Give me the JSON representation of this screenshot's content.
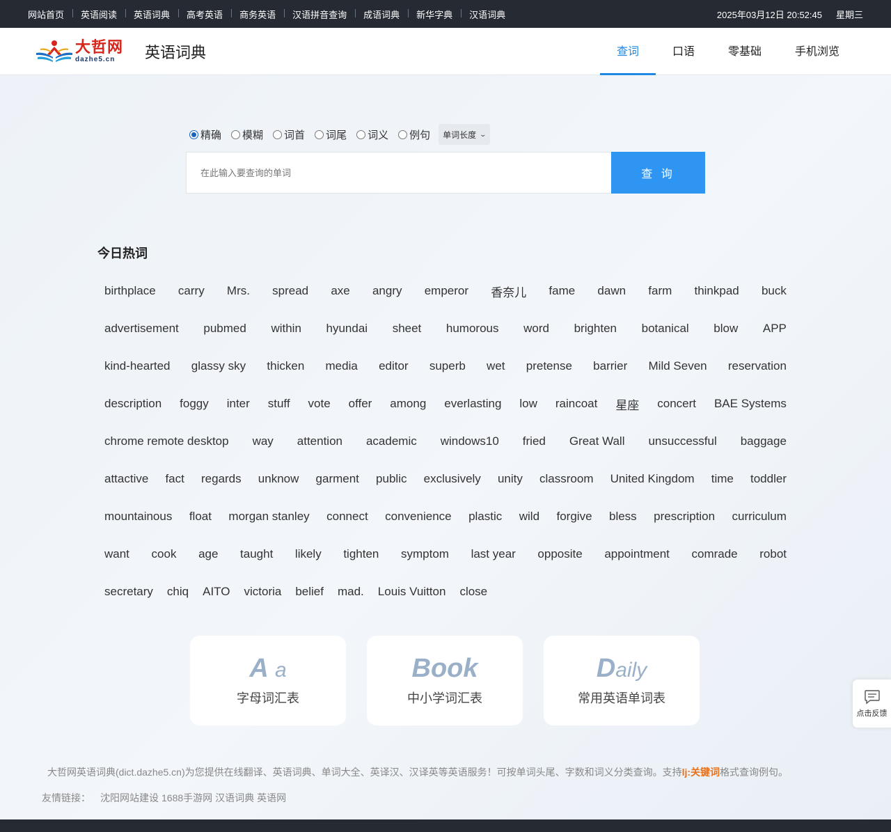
{
  "topbar": {
    "links": [
      "网站首页",
      "英语阅读",
      "英语词典",
      "高考英语",
      "商务英语",
      "汉语拼音查询",
      "成语词典",
      "新华字典",
      "汉语词典"
    ],
    "datetime": "2025年03月12日 20:52:45",
    "weekday": "星期三"
  },
  "header": {
    "logo_cn": "大哲网",
    "logo_en": "dazhe5.cn",
    "site_title": "英语词典",
    "nav": [
      "查词",
      "口语",
      "零基础",
      "手机浏览"
    ],
    "active_nav": "查词"
  },
  "search": {
    "modes": [
      "精确",
      "模糊",
      "词首",
      "词尾",
      "词义",
      "例句"
    ],
    "selected_mode": "精确",
    "length_select": "单词长度",
    "placeholder": "在此输入要查询的单词",
    "value": "",
    "button": "查 询"
  },
  "hot": {
    "title": "今日热词",
    "rows": [
      [
        "birthplace",
        "carry",
        "Mrs.",
        "spread",
        "axe",
        "angry",
        "emperor",
        "香奈儿",
        "fame",
        "dawn",
        "farm",
        "thinkpad",
        "buck"
      ],
      [
        "advertisement",
        "pubmed",
        "within",
        "hyundai",
        "sheet",
        "humorous",
        "word",
        "brighten",
        "botanical",
        "blow",
        "APP"
      ],
      [
        "kind-hearted",
        "glassy sky",
        "thicken",
        "media",
        "editor",
        "superb",
        "wet",
        "pretense",
        "barrier",
        "Mild Seven",
        "reservation"
      ],
      [
        "description",
        "foggy",
        "inter",
        "stuff",
        "vote",
        "offer",
        "among",
        "everlasting",
        "low",
        "raincoat",
        "星座",
        "concert",
        "BAE Systems"
      ],
      [
        "chrome remote desktop",
        "way",
        "attention",
        "academic",
        "windows10",
        "fried",
        "Great Wall",
        "unsuccessful",
        "baggage"
      ],
      [
        "attactive",
        "fact",
        "regards",
        "unknow",
        "garment",
        "public",
        "exclusively",
        "unity",
        "classroom",
        "United Kingdom",
        "time",
        "toddler"
      ],
      [
        "mountainous",
        "float",
        "morgan stanley",
        "connect",
        "convenience",
        "plastic",
        "wild",
        "forgive",
        "bless",
        "prescription",
        "curriculum"
      ],
      [
        "want",
        "cook",
        "age",
        "taught",
        "likely",
        "tighten",
        "symptom",
        "last year",
        "opposite",
        "appointment",
        "comrade",
        "robot"
      ],
      [
        "secretary",
        "chiq",
        "AITO",
        "victoria",
        "belief",
        "mad.",
        "Louis Vuitton",
        "close"
      ]
    ]
  },
  "cards": [
    {
      "big": "A",
      "big_small": "a",
      "label": "字母词汇表"
    },
    {
      "big": "B",
      "big_small": "ook",
      "label": "中小学词汇表"
    },
    {
      "big": "D",
      "big_small": "aily",
      "label": "常用英语单词表"
    }
  ],
  "feedback": {
    "label": "点击反馈",
    "icon": "comment-icon"
  },
  "footer": {
    "desc_before": "大哲网英语词典(dict.dazhe5.cn)为您提供在线翻译、英语词典、单词大全、英译汉、汉译英等英语服务！可按单词头尾、字数和词义分类查询。支持",
    "desc_highlight": "lj:关键词",
    "desc_after": "格式查询例句。",
    "links_label": "友情链接：",
    "links": [
      "沈阳网站建设",
      "1688手游网",
      "汉语词典",
      "英语网"
    ]
  },
  "colors": {
    "accent": "#1e88e5",
    "button": "#2f95f3",
    "topbar": "#252a33",
    "highlight": "#e8721c"
  }
}
